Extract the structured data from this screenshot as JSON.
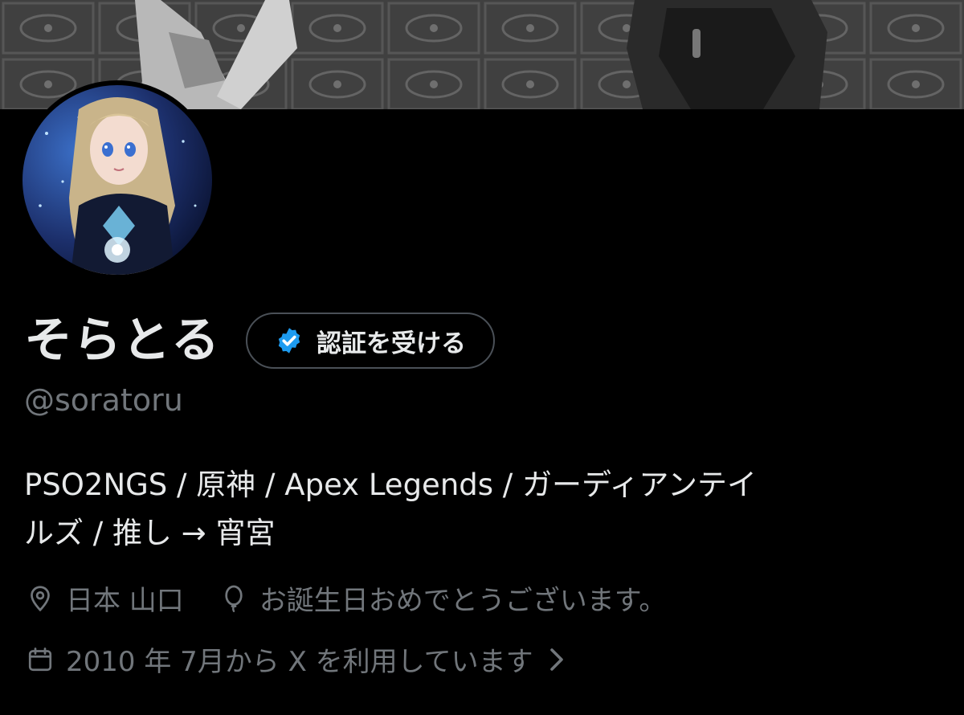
{
  "profile": {
    "display_name": "そらとる",
    "verify_label": "認証を受ける",
    "handle": "@soratoru",
    "bio_line1": "PSO2NGS / 原神 / Apex Legends / ガーディアンテイ",
    "bio_line2": "ルズ / 推し → 宵宮",
    "location": "日本 山口",
    "birthday": "お誕生日おめでとうございます。",
    "joined": "2010 年 7月から X を利用しています"
  },
  "icons": {
    "verified": "verified-badge-icon",
    "location": "location-pin-icon",
    "birthday": "balloon-icon",
    "joined": "calendar-icon",
    "chevron": "chevron-right-icon"
  },
  "colors": {
    "background": "#000000",
    "text_primary": "#e7e9ea",
    "text_secondary": "#71767b",
    "verified_blue": "#1d9bf0",
    "button_border": "#4a5057"
  }
}
